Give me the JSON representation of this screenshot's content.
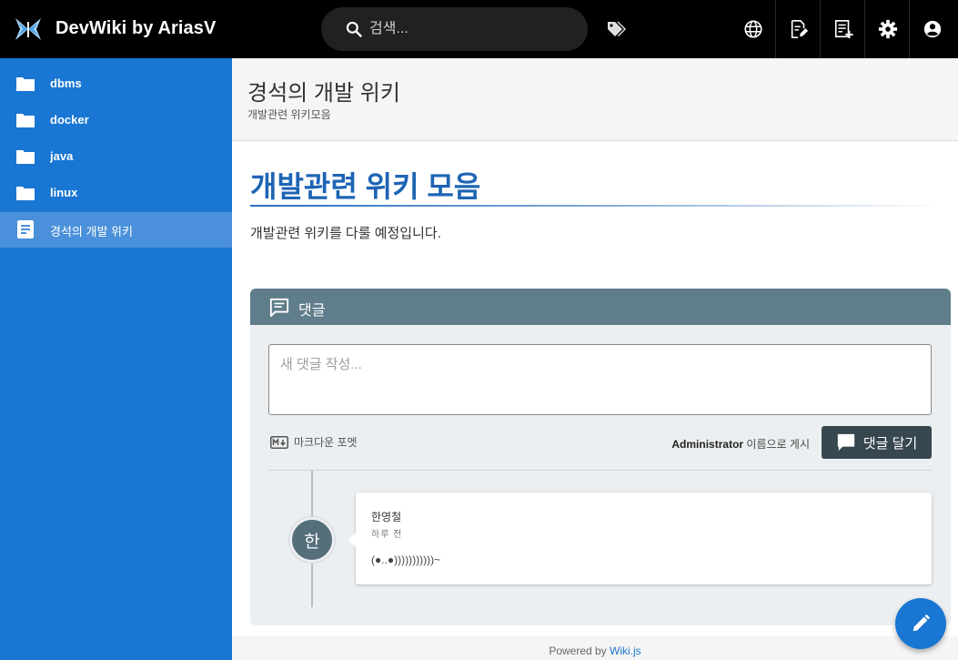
{
  "app": {
    "title": "DevWiki by AriasV"
  },
  "search": {
    "placeholder": "검색..."
  },
  "sidebar": {
    "items": [
      {
        "label": "dbms",
        "icon": "folder-icon"
      },
      {
        "label": "docker",
        "icon": "folder-icon"
      },
      {
        "label": "java",
        "icon": "folder-icon"
      },
      {
        "label": "linux",
        "icon": "folder-icon"
      },
      {
        "label": "경석의 개발 위키",
        "icon": "page-icon",
        "active": true
      }
    ]
  },
  "page": {
    "title": "경석의 개발 위키",
    "subtitle": "개발관련 위키모음",
    "heading": "개발관련 위키 모음",
    "paragraph": "개발관련 위키를 다룰 예정입니다."
  },
  "comments": {
    "title": "댓글",
    "textarea_placeholder": "새 댓글 작성...",
    "markdown_label": "마크다운 포멧",
    "post_as_user": "Administrator",
    "post_as_suffix": " 이름으로 게시",
    "post_button": "댓글 달기",
    "items": [
      {
        "avatar": "한",
        "author": "한영철",
        "time": "하루 전",
        "body": "(●..●)))))))))))~"
      }
    ]
  },
  "footer": {
    "prefix": "Powered by ",
    "link": "Wiki.js"
  },
  "colors": {
    "topbar": "#000000",
    "sidebar": "#1976d2",
    "sidebar_active": "#4a90da",
    "heading": "#1e64b4",
    "comment_header": "#607d8b",
    "post_button": "#37474f"
  }
}
